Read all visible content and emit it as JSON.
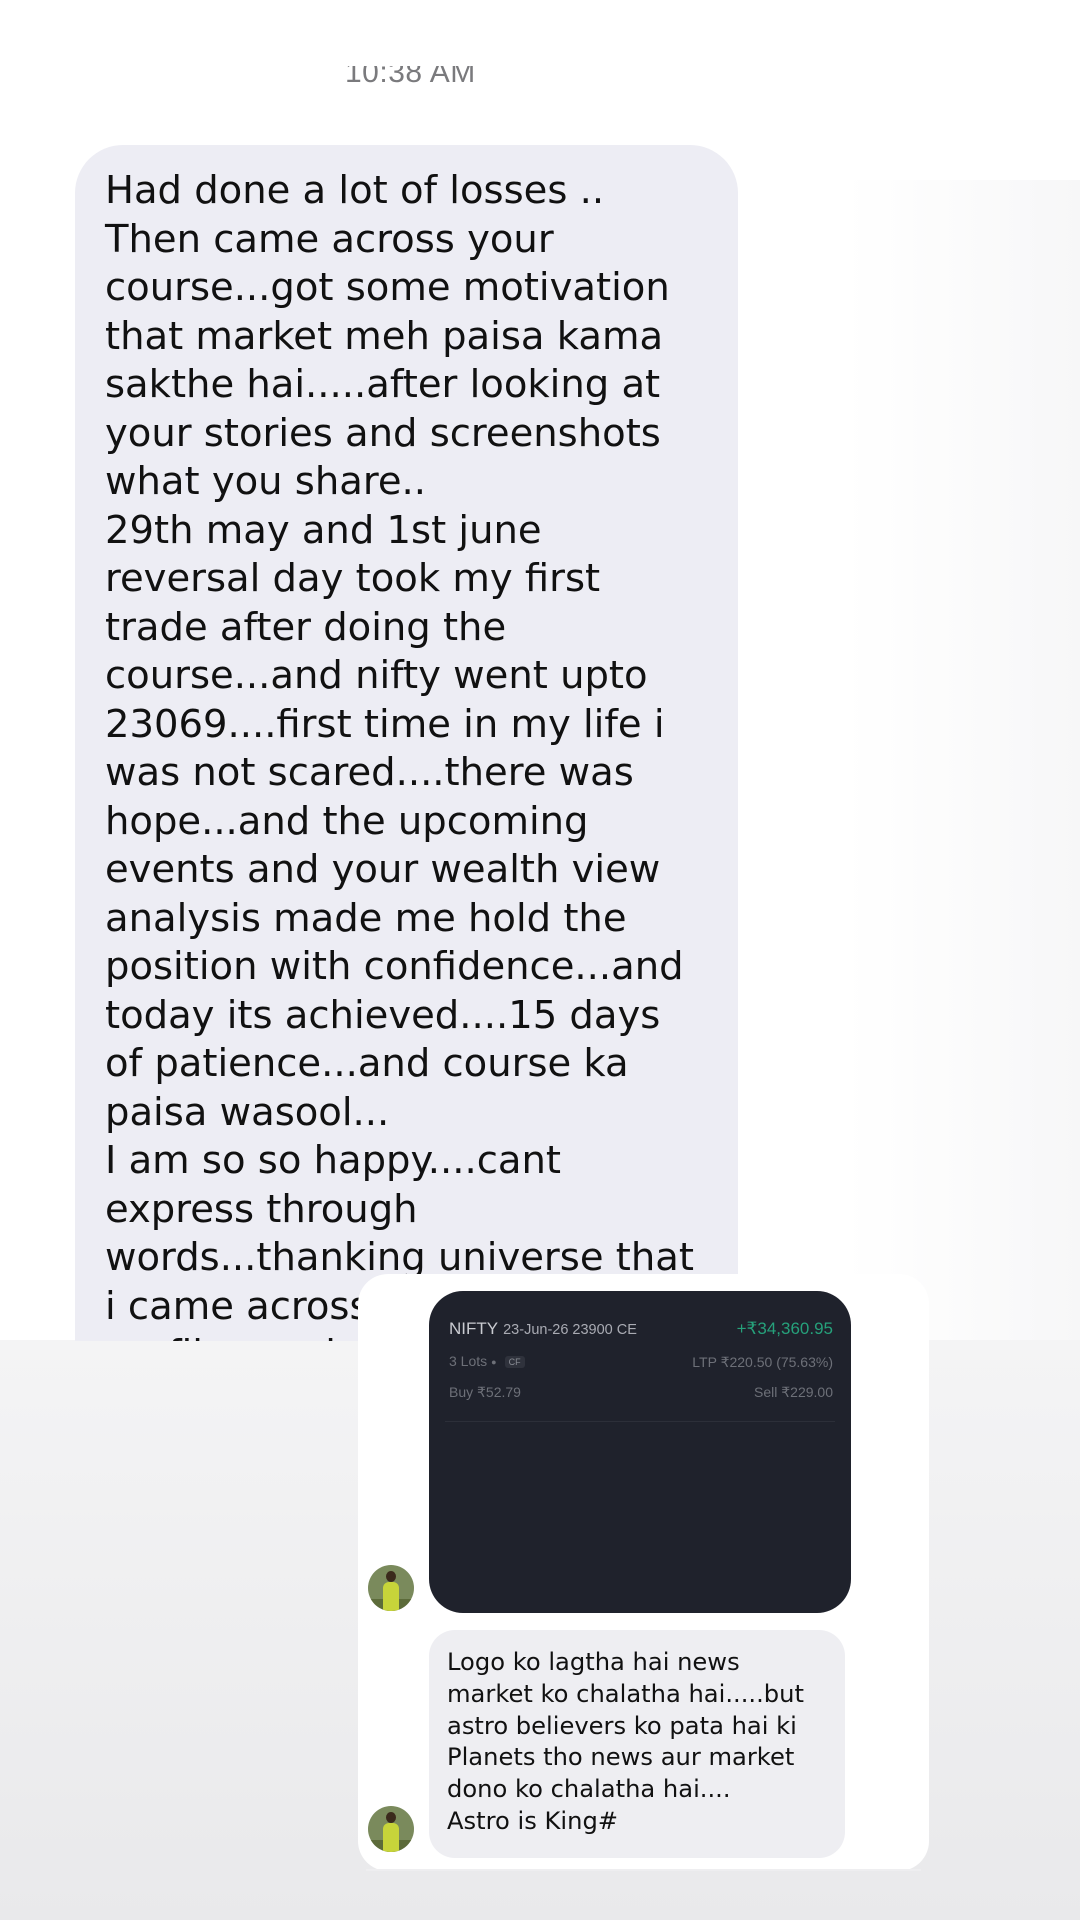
{
  "chat": {
    "timestamp": "10:38 AM",
    "message_text": "Had done a lot of losses ..\nThen came across your course...got some motivation that market meh paisa kama sakthe hai.....after looking at your stories and screenshots what you share..\n29th may and 1st june reversal day took my first trade after doing the course...and nifty went upto 23069....first time in my life i was not scared....there was hope...and the upcoming events and your wealth view analysis made me hold the position with confidence...and today its achieved....15 days of patience...and course ka paisa wasool...\nI am so so happy....cant express through words...thanking universe that i came across your profile...and did your course....having been helped"
  },
  "shared_post": {
    "trade": {
      "symbol": "NIFTY",
      "contract": "23-Jun-26 23900 CE",
      "pnl": "+₹34,360.95",
      "lots": "3 Lots",
      "tag": "CF",
      "ltp": "LTP ₹220.50  (75.63%)",
      "buy": "Buy ₹52.79",
      "sell": "Sell ₹229.00"
    },
    "caption": "Logo ko lagtha hai news market ko chalatha hai.....but astro believers ko pata hai ki Planets tho news aur market dono ko chalatha hai....\nAstro is King#"
  },
  "colors": {
    "bubble_bg": "#ededf4",
    "trade_card_bg": "#1f222c",
    "profit_green": "#26a17b",
    "caption_bg": "#eeeef2"
  },
  "icons": {
    "avatar": "profile-photo-avatar"
  }
}
